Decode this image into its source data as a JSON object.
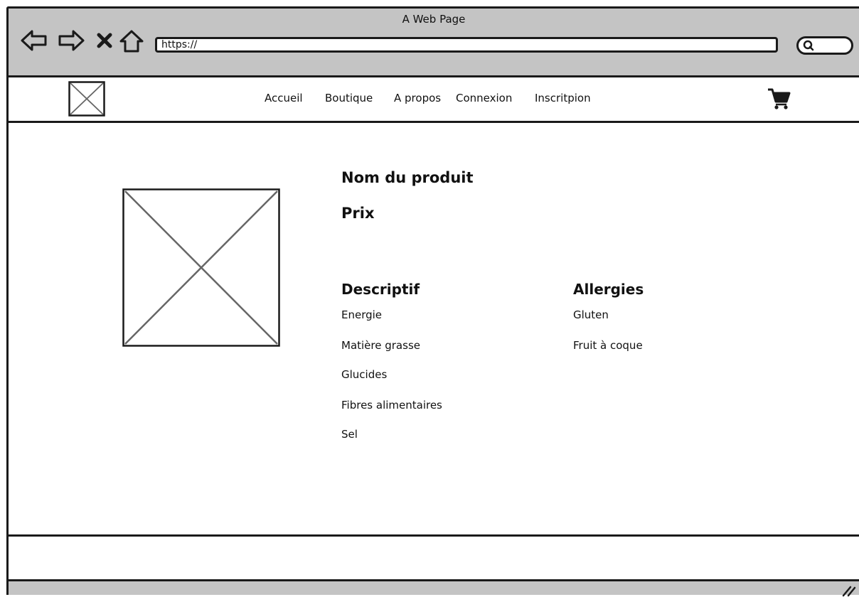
{
  "browser": {
    "title": "A Web Page",
    "url": "https://"
  },
  "site_nav": {
    "items": [
      {
        "label": "Accueil"
      },
      {
        "label": "Boutique"
      },
      {
        "label": "A propos"
      },
      {
        "label": "Connexion"
      },
      {
        "label": "Inscritpion"
      }
    ]
  },
  "product": {
    "name": "Nom du produit",
    "price_label": "Prix",
    "description": {
      "title": "Descriptif",
      "items": [
        "Energie",
        "Matière grasse",
        "Glucides",
        "Fibres alimentaires",
        "Sel"
      ]
    },
    "allergies": {
      "title": "Allergies",
      "items": [
        "Gluten",
        "Fruit à coque"
      ]
    }
  },
  "icons": {
    "back": "arrow-left-icon",
    "forward": "arrow-right-icon",
    "stop": "close-icon",
    "home": "home-icon",
    "search": "search-icon",
    "cart": "cart-icon",
    "resize": "resize-grip-icon"
  },
  "colors": {
    "chrome": "#c4c4c4",
    "ink": "#1a1a1a",
    "placeholder_stroke": "#666666"
  }
}
